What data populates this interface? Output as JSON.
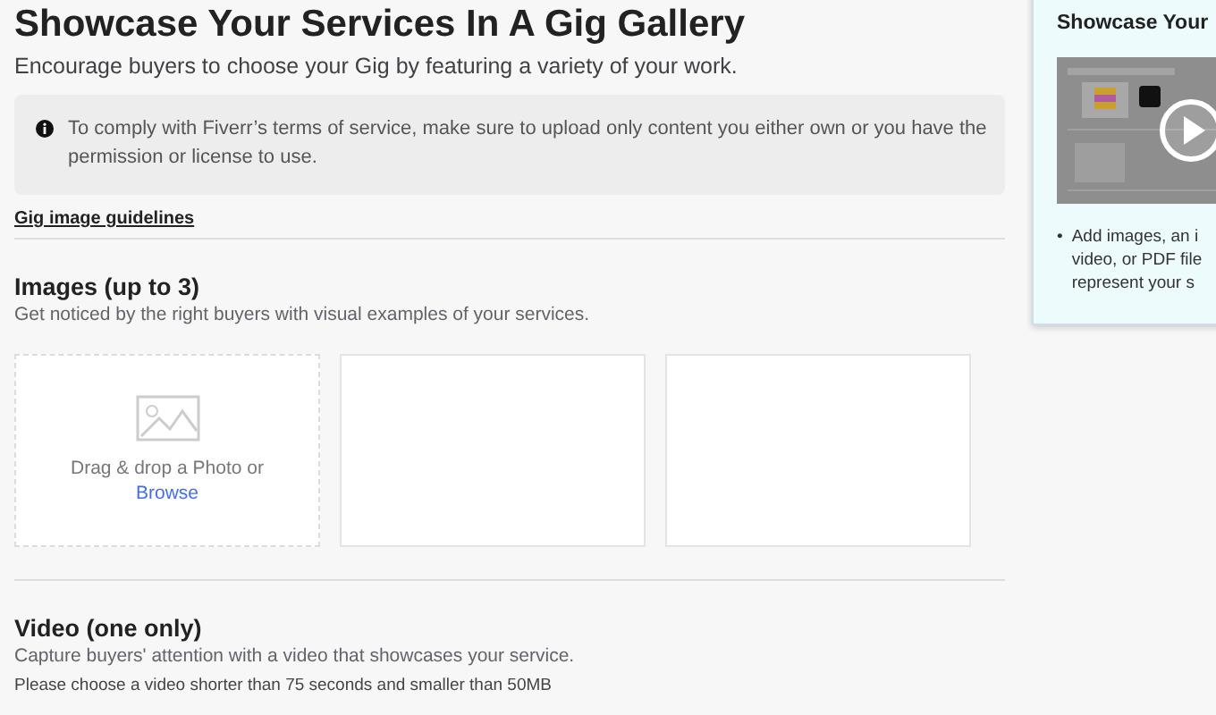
{
  "title": "Showcase Your Services In A Gig Gallery",
  "subtitle": "Encourage buyers to choose your Gig by featuring a variety of your work.",
  "notice": "To comply with Fiverr’s terms of service, make sure to upload only content you either own or you have the permission or license to use.",
  "guidelines_link": "Gig image guidelines",
  "images": {
    "heading": "Images (up to 3)",
    "description": "Get noticed by the right buyers with visual examples of your services.",
    "slots": [
      {
        "kind": "dropzone",
        "text": "Drag & drop a Photo or",
        "link": "Browse"
      },
      {
        "kind": "empty"
      },
      {
        "kind": "empty"
      }
    ]
  },
  "video": {
    "heading": "Video (one only)",
    "description": "Capture buyers' attention with a video that showcases your service.",
    "note": "Please choose a video shorter than 75 seconds and smaller than 50MB"
  },
  "side_panel": {
    "title": "Showcase Your",
    "bullets": [
      {
        "marker": "•",
        "text": "Add images, an i\nvideo, or PDF file\nrepresent your s"
      }
    ]
  }
}
